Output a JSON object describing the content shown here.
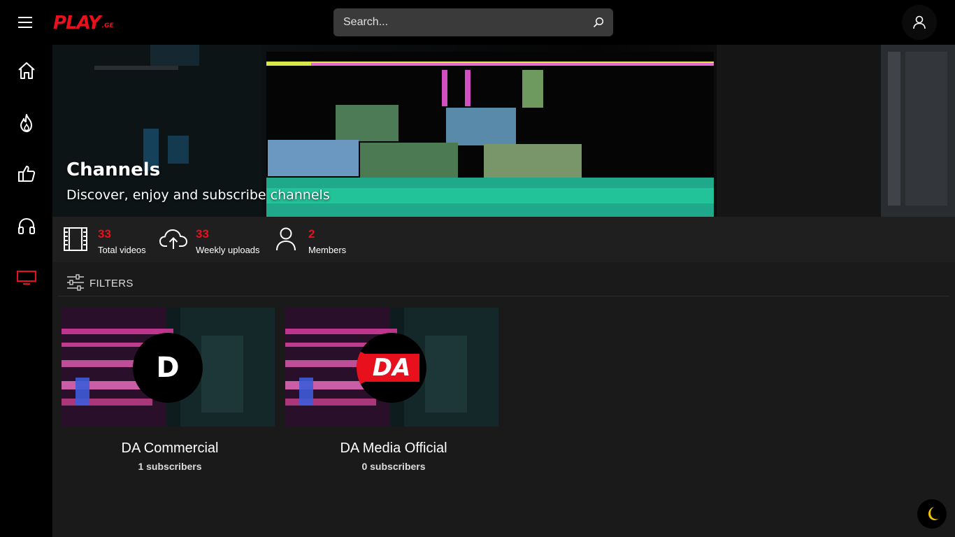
{
  "header": {
    "logo_text": "PLAY",
    "logo_suffix": ".GE",
    "search_placeholder": "Search..."
  },
  "sidebar": {
    "items": [
      {
        "name": "home",
        "icon": "home-icon",
        "active": false
      },
      {
        "name": "trending",
        "icon": "fire-icon",
        "active": false
      },
      {
        "name": "liked",
        "icon": "thumbs-up-icon",
        "active": false
      },
      {
        "name": "music",
        "icon": "headphones-icon",
        "active": false
      },
      {
        "name": "channels",
        "icon": "tv-icon",
        "active": true
      }
    ]
  },
  "hero": {
    "title": "Channels",
    "subtitle": "Discover, enjoy and subscribe channels"
  },
  "stats": [
    {
      "value": "33",
      "label": "Total videos",
      "icon": "film-icon"
    },
    {
      "value": "33",
      "label": "Weekly uploads",
      "icon": "cloud-upload-icon"
    },
    {
      "value": "2",
      "label": "Members",
      "icon": "user-icon"
    }
  ],
  "filters": {
    "label": "FILTERS"
  },
  "channels": [
    {
      "name": "DA Commercial",
      "subscribers": "1 subscribers",
      "avatar": "D"
    },
    {
      "name": "DA Media Official",
      "subscribers": "0 subscribers",
      "avatar": "DA"
    }
  ],
  "colors": {
    "accent": "#e8101d",
    "background": "#1a1a1a",
    "sidebar": "#000000",
    "theme_toggle": "#f5c400"
  }
}
